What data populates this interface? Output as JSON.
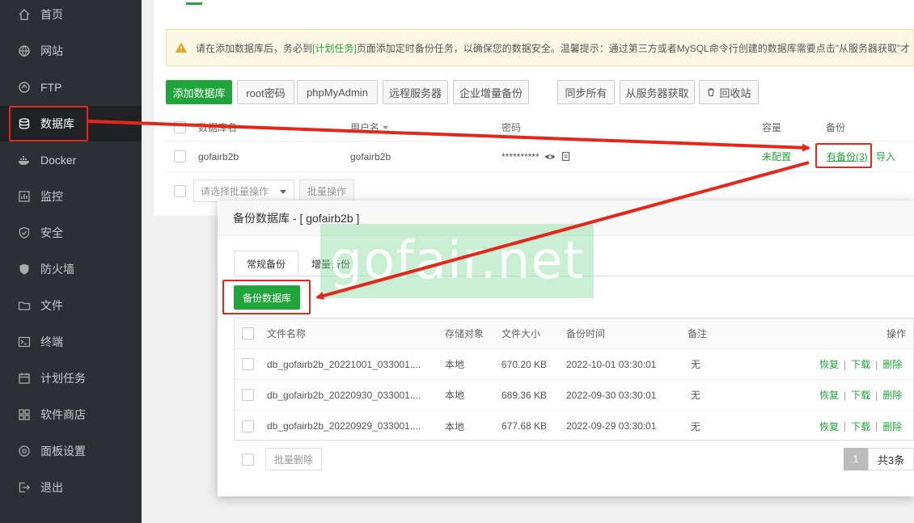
{
  "sidebar": {
    "items": [
      {
        "label": "首页",
        "icon": "home-icon"
      },
      {
        "label": "网站",
        "icon": "globe-icon"
      },
      {
        "label": "FTP",
        "icon": "ftp-icon"
      },
      {
        "label": "数据库",
        "icon": "database-icon",
        "active": true
      },
      {
        "label": "Docker",
        "icon": "docker-icon"
      },
      {
        "label": "监控",
        "icon": "monitor-icon"
      },
      {
        "label": "安全",
        "icon": "shield-icon"
      },
      {
        "label": "防火墙",
        "icon": "firewall-icon"
      },
      {
        "label": "文件",
        "icon": "folder-icon"
      },
      {
        "label": "终端",
        "icon": "terminal-icon"
      },
      {
        "label": "计划任务",
        "icon": "calendar-icon"
      },
      {
        "label": "软件商店",
        "icon": "apps-icon"
      },
      {
        "label": "面板设置",
        "icon": "settings-icon"
      },
      {
        "label": "退出",
        "icon": "logout-icon"
      }
    ]
  },
  "alert": {
    "text_before": "请在添加数据库后，务必到",
    "link": "[计划任务]",
    "text_after": "页面添加定时备份任务，以确保您的数据安全。温馨提示：通过第三方或者MySQL命令行创建的数据库需要点击\"从服务器获取\"才"
  },
  "toolbar": {
    "add_db": "添加数据库",
    "root_pwd": "root密码",
    "phpmyadmin": "phpMyAdmin",
    "remote_server": "远程服务器",
    "enterprise_backup": "企业增量备份",
    "sync_all": "同步所有",
    "fetch_from_server": "从服务器获取",
    "recycle_bin": "回收站"
  },
  "db_table": {
    "headers": {
      "name": "数据库名",
      "user": "用户名",
      "password": "密码",
      "capacity": "容量",
      "backup": "备份"
    },
    "row": {
      "name": "gofairb2b",
      "user": "gofairb2b",
      "password": "**********",
      "capacity": "未配置",
      "backup": "有备份(3)",
      "import": "导入"
    },
    "batch_placeholder": "请选择批量操作",
    "batch_button": "批量操作"
  },
  "dialog": {
    "title": "备份数据库 - [ gofairb2b ]",
    "tabs": [
      "常规备份",
      "增量备份"
    ],
    "backup_button": "备份数据库",
    "headers": {
      "filename": "文件名称",
      "storage": "存储对象",
      "size": "文件大小",
      "time": "备份时间",
      "note": "备注",
      "actions": "操作"
    },
    "rows": [
      {
        "filename": "db_gofairb2b_20221001_033001....",
        "storage": "本地",
        "size": "670.20 KB",
        "time": "2022-10-01 03:30:01",
        "note": "无"
      },
      {
        "filename": "db_gofairb2b_20220930_033001....",
        "storage": "本地",
        "size": "689.36 KB",
        "time": "2022-09-30 03:30:01",
        "note": "无"
      },
      {
        "filename": "db_gofairb2b_20220929_033001....",
        "storage": "本地",
        "size": "677.68 KB",
        "time": "2022-09-29 03:30:01",
        "note": "无"
      }
    ],
    "actions": {
      "restore": "恢复",
      "download": "下载",
      "delete": "删除",
      "separator": "|"
    },
    "batch_delete": "批量删除",
    "page": "1",
    "total": "共3条"
  },
  "watermark": "gofair.net",
  "colors": {
    "accent": "#20a53a",
    "annotation": "#e5261b",
    "sidebar": "#2c2f33"
  }
}
